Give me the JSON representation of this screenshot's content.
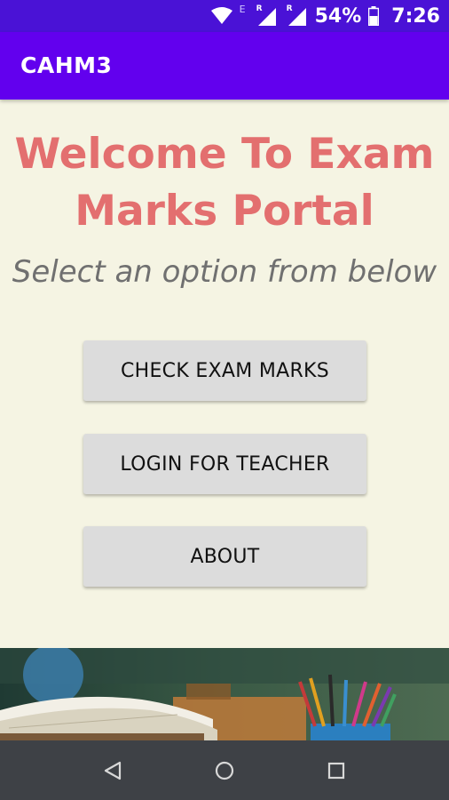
{
  "status_bar": {
    "network_badge": "E",
    "roaming_badge_1": "R",
    "roaming_badge_2": "R",
    "battery_percent": "54%",
    "time": "7:26",
    "icons": [
      "wifi-icon",
      "signal-icon",
      "signal-icon",
      "battery-icon"
    ]
  },
  "app_bar": {
    "title": "CAHM3"
  },
  "main": {
    "welcome_line1": "Welcome To Exam",
    "welcome_line2": "Marks Portal",
    "subtitle": "Select an option from below",
    "buttons": {
      "check_marks": "CHECK EXAM MARKS",
      "teacher_login": "LOGIN FOR TEACHER",
      "about": "ABOUT"
    }
  },
  "banner": {
    "image": "classroom-books-pencils-illustration"
  },
  "nav_bar": {
    "icons": [
      "back-icon",
      "home-icon",
      "recents-icon"
    ]
  },
  "colors": {
    "status_bar": "#4A12D6",
    "app_bar": "#6200EE",
    "background": "#F5F4E3",
    "heading": "#E36F6F",
    "subtitle": "#707070",
    "button_bg": "#DCDCDC",
    "nav_bar": "#3E4146"
  }
}
